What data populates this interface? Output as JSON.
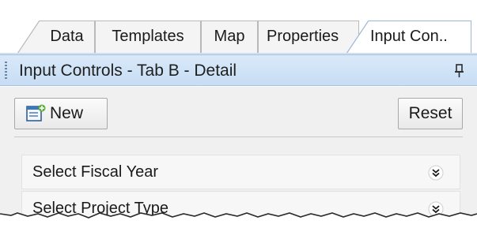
{
  "tabs": [
    {
      "label": "Data",
      "active": false
    },
    {
      "label": "Templates",
      "active": false
    },
    {
      "label": "Map",
      "active": false
    },
    {
      "label": "Propertie­­s",
      "active": false
    },
    {
      "label": "Input Con..",
      "active": true
    }
  ],
  "panel": {
    "title": "Input Controls - Tab B - Detail"
  },
  "toolbar": {
    "new_label": "New",
    "reset_label": "Reset"
  },
  "controls": [
    {
      "label": "Select Fiscal Year"
    },
    {
      "label": "Select Project Type"
    }
  ],
  "colors": {
    "header_bg": "#d2e4f7",
    "panel_bg": "#f0f0f0",
    "active_tab_border": "#9cb8d6"
  },
  "icons": {
    "new": "new-document-icon",
    "pin": "pin-icon",
    "expand": "double-chevron-down-icon"
  }
}
